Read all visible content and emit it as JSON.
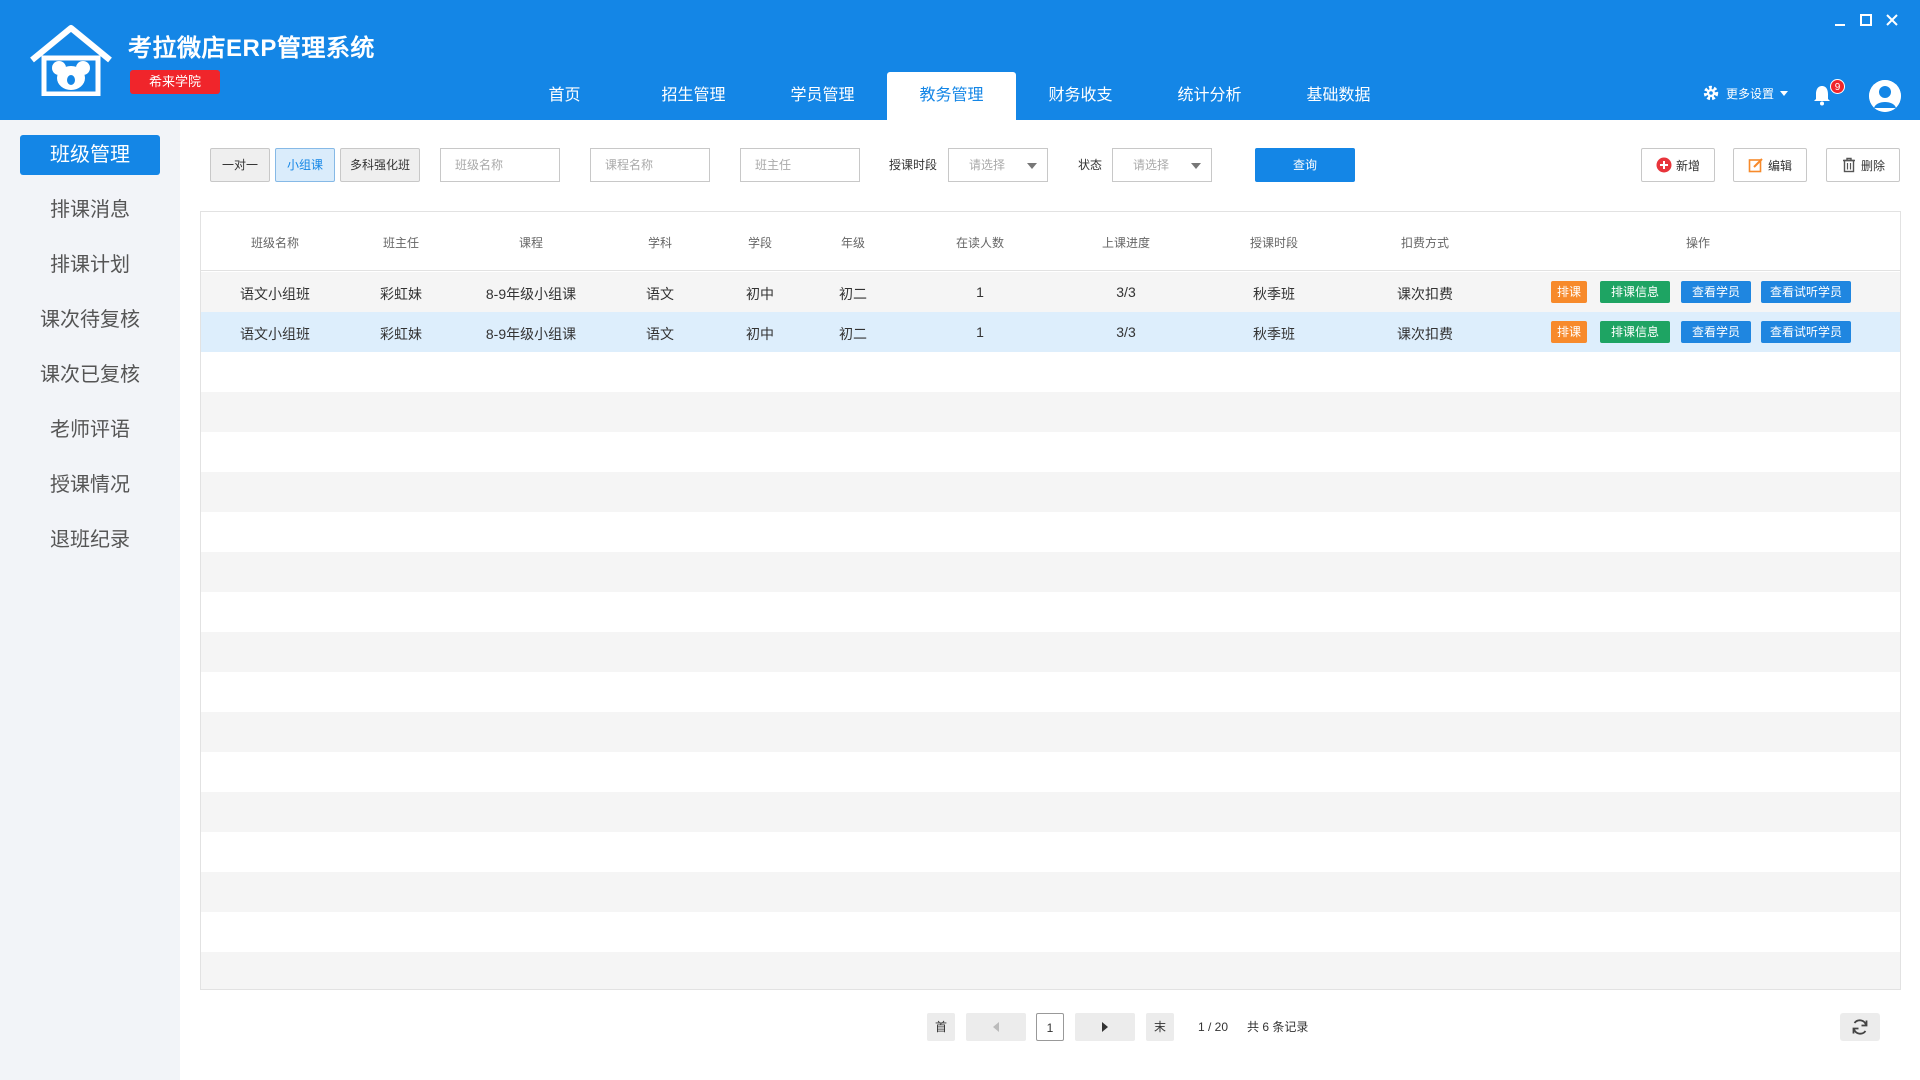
{
  "app": {
    "title": "考拉微店ERP管理系统",
    "school": "希来学院"
  },
  "nav": [
    "首页",
    "招生管理",
    "学员管理",
    "教务管理",
    "财务收支",
    "统计分析",
    "基础数据"
  ],
  "header": {
    "settings": "更多设置",
    "notification_count": "9"
  },
  "sidebar": [
    "班级管理",
    "排课消息",
    "排课计划",
    "课次待复核",
    "课次已复核",
    "老师评语",
    "授课情况",
    "退班纪录"
  ],
  "toolbar": {
    "class_types": [
      "一对一",
      "小组课",
      "多科强化班"
    ],
    "class_name_placeholder": "班级名称",
    "course_name_placeholder": "课程名称",
    "teacher_placeholder": "班主任",
    "period_label": "授课时段",
    "status_label": "状态",
    "select_placeholder": "请选择",
    "query": "查询",
    "add": "新增",
    "edit": "编辑",
    "delete": "删除"
  },
  "table": {
    "columns": [
      "班级名称",
      "班主任",
      "课程",
      "学科",
      "学段",
      "年级",
      "在读人数",
      "上课进度",
      "授课时段",
      "扣费方式",
      "操作"
    ],
    "rows": [
      [
        "语文小组班",
        "彩虹妹",
        "8-9年级小组课",
        "语文",
        "初中",
        "初二",
        "1",
        "3/3",
        "秋季班",
        "课次扣费"
      ],
      [
        "语文小组班",
        "彩虹妹",
        "8-9年级小组课",
        "语文",
        "初中",
        "初二",
        "1",
        "3/3",
        "秋季班",
        "课次扣费"
      ]
    ],
    "actions": [
      "排课",
      "排课信息",
      "查看学员",
      "查看试听学员"
    ]
  },
  "pagination": {
    "first": "首",
    "page": "1",
    "last": "末",
    "page_info": "1 / 20",
    "total": "共 6 条记录"
  },
  "colors": {
    "primary": "#1486e6",
    "badge": "#f0252b",
    "orange": "#f78a2b",
    "green": "#1ea463"
  }
}
